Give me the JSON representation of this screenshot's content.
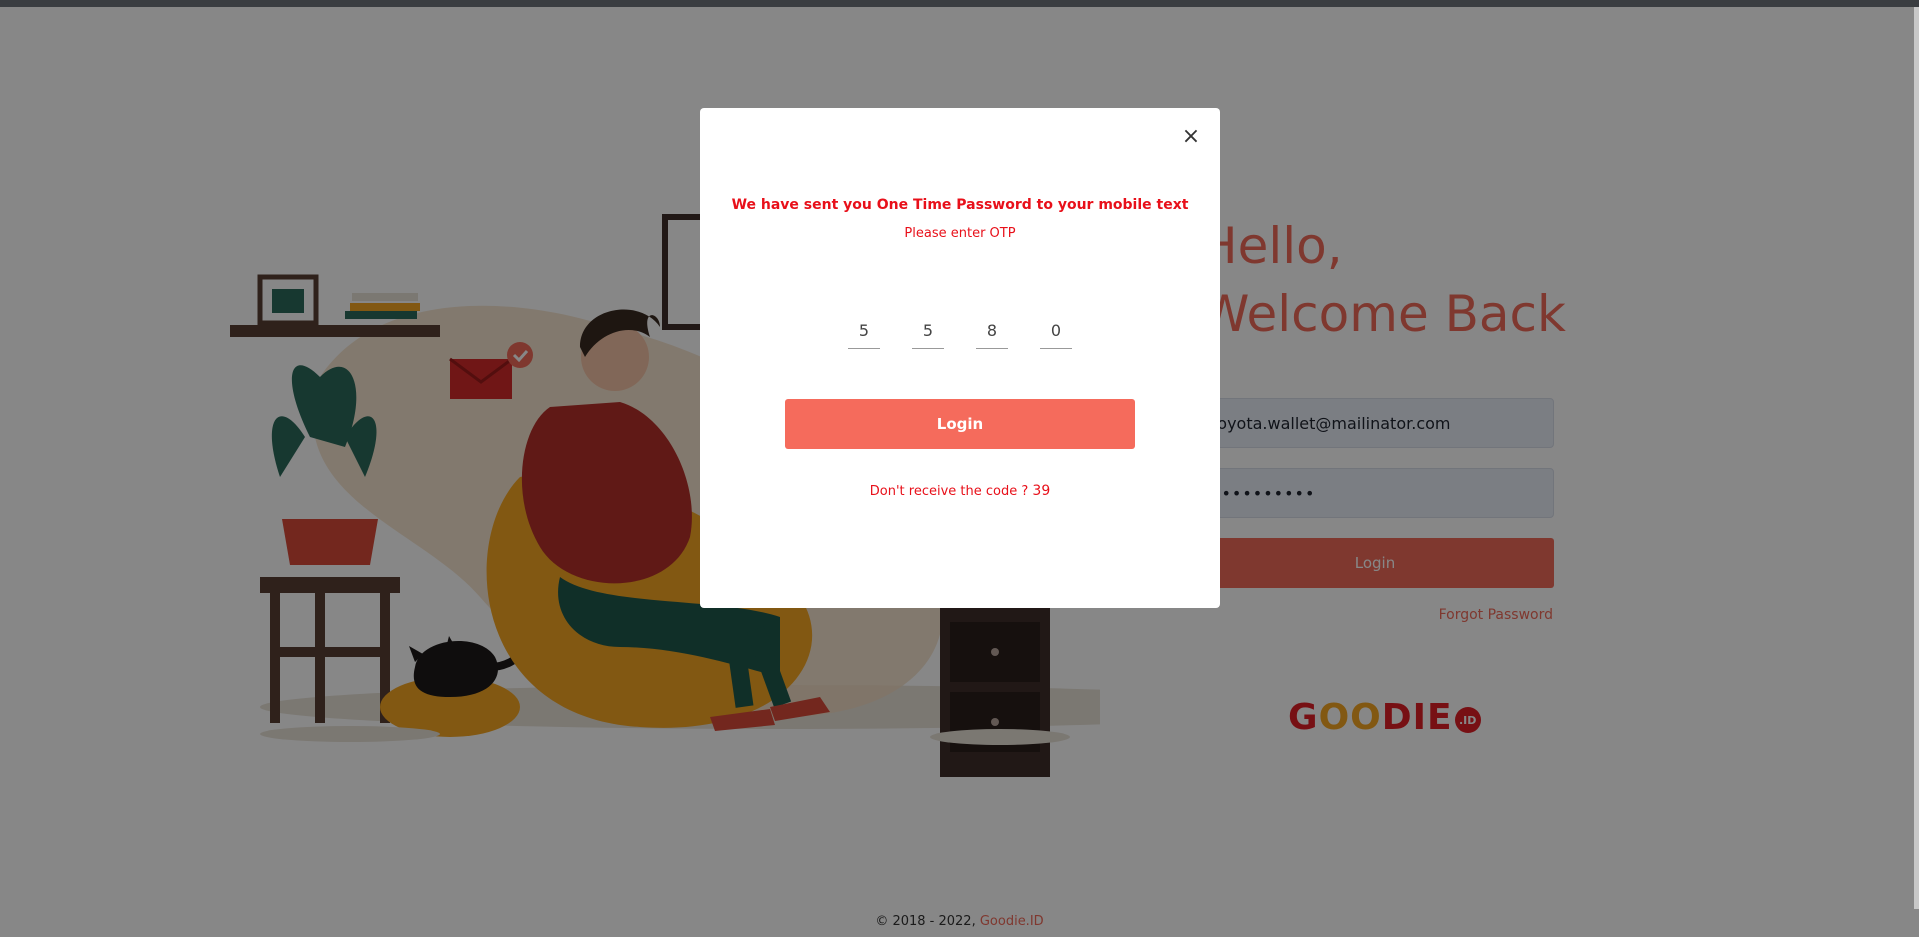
{
  "hero": {
    "line1": "Hello,",
    "line2": "Welcome Back"
  },
  "form": {
    "email_value": "toyota.wallet@mailinator.com",
    "password_value": "••••••••••",
    "login_label": "Login",
    "forgot_label": "Forgot Password"
  },
  "logo": {
    "text_g": "G",
    "text_oo": "OO",
    "text_die": "DIE",
    "badge": ".ID"
  },
  "footer": {
    "copyright": "© 2018 - 2022, ",
    "brand_link": "Goodie.ID"
  },
  "modal": {
    "close_glyph": "×",
    "title": "We have sent you One Time Password to your mobile text",
    "subtitle": "Please enter OTP",
    "otp_digits": [
      "5",
      "5",
      "8",
      "0"
    ],
    "login_label": "Login",
    "resend_text": "Don't receive the code ? ",
    "countdown": "39"
  },
  "colors": {
    "accent": "#f06a5a",
    "error_red": "#e8101a",
    "brand_red": "#e11f26",
    "brand_orange": "#f5a623"
  }
}
